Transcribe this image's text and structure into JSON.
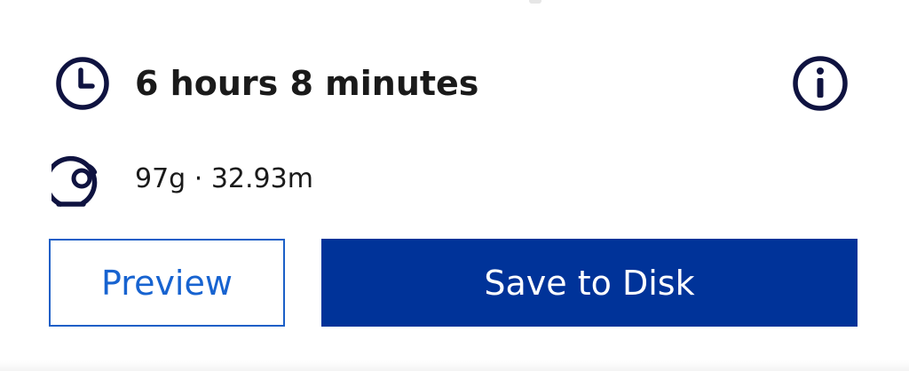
{
  "print_summary": {
    "time": {
      "icon": "clock-icon",
      "label": "6 hours 8 minutes"
    },
    "info": {
      "icon": "info-icon"
    },
    "material": {
      "icon": "filament-spool-icon",
      "label": "97g · 32.93m"
    }
  },
  "actions": {
    "preview_label": "Preview",
    "save_label": "Save to Disk"
  },
  "colors": {
    "icon": "#0f1340",
    "text": "#1a1a1a",
    "preview_border": "#1b5fc7",
    "preview_text": "#1763d0",
    "save_background": "#003399",
    "save_text": "#ffffff"
  }
}
